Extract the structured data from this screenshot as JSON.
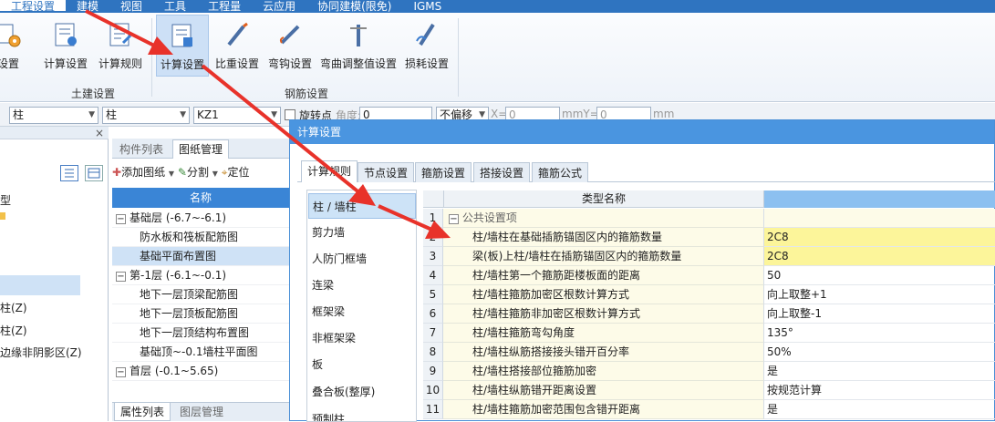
{
  "menubar": {
    "items": [
      "工程设置",
      "建模",
      "视图",
      "工具",
      "工程量",
      "云应用",
      "协同建模(限免)",
      "IGMS"
    ]
  },
  "ribbon": {
    "partial_button_label": "设置",
    "buttons": [
      {
        "label": "计算设置"
      },
      {
        "label": "计算规则"
      },
      {
        "label": "计算设置"
      },
      {
        "label": "比重设置"
      },
      {
        "label": "弯钩设置"
      },
      {
        "label": "弯曲调整值设置"
      },
      {
        "label": "损耗设置"
      }
    ],
    "groups": [
      "土建设置",
      "钢筋设置"
    ]
  },
  "propbar": {
    "combo1": "柱",
    "combo2": "柱",
    "combo3": "KZ1",
    "rotate_label": "旋转点",
    "angle_label": "角度:",
    "angle_value": "0",
    "offset_value": "不偏移",
    "x_label": "X=",
    "x_value": "0",
    "mm_y": "mmY=",
    "y_value": "0",
    "mm": "mm"
  },
  "leftpanel": {
    "close": "×",
    "items": [
      "型",
      "柱(Z)",
      "柱(Z)",
      "边缘非阴影区(Z)"
    ]
  },
  "midpanel": {
    "tabs": [
      "构件列表",
      "图纸管理"
    ],
    "toolbar": {
      "add": "添加图纸",
      "split": "分割",
      "locate": "定位"
    },
    "header": "名称",
    "rows": [
      {
        "text": "基础层 (-6.7~-6.1)",
        "group": true,
        "toggle": "−"
      },
      {
        "text": "防水板和筏板配筋图",
        "group": false
      },
      {
        "text": "基础平面布置图",
        "group": false,
        "selected": true
      },
      {
        "text": "第-1层 (-6.1~-0.1)",
        "group": true,
        "toggle": "−"
      },
      {
        "text": "地下一层顶梁配筋图",
        "group": false
      },
      {
        "text": "地下一层顶板配筋图",
        "group": false
      },
      {
        "text": "地下一层顶结构布置图",
        "group": false
      },
      {
        "text": "基础顶~-0.1墙柱平面图",
        "group": false
      },
      {
        "text": "首层 (-0.1~5.65)",
        "group": true,
        "toggle": "−"
      }
    ],
    "bottom_tabs": [
      "属性列表",
      "图层管理"
    ]
  },
  "dialog": {
    "title": "计算设置",
    "tabs": [
      "计算规则",
      "节点设置",
      "箍筋设置",
      "搭接设置",
      "箍筋公式"
    ],
    "categories": [
      "柱 / 墙柱",
      "剪力墙",
      "人防门框墙",
      "连梁",
      "框架梁",
      "非框架梁",
      "板",
      "叠合板(整厚)",
      "预制柱"
    ],
    "grid_header": "类型名称",
    "section": {
      "num": "1",
      "toggle": "−",
      "label": "公共设置项"
    },
    "rows": [
      {
        "num": "2",
        "name": "柱/墙柱在基础插筋锚固区内的箍筋数量",
        "value": "2C8",
        "hl": true
      },
      {
        "num": "3",
        "name": "梁(板)上柱/墙柱在插筋锚固区内的箍筋数量",
        "value": "2C8",
        "hl": true
      },
      {
        "num": "4",
        "name": "柱/墙柱第一个箍筋距楼板面的距离",
        "value": "50"
      },
      {
        "num": "5",
        "name": "柱/墙柱箍筋加密区根数计算方式",
        "value": "向上取整+1"
      },
      {
        "num": "6",
        "name": "柱/墙柱箍筋非加密区根数计算方式",
        "value": "向上取整-1"
      },
      {
        "num": "7",
        "name": "柱/墙柱箍筋弯勾角度",
        "value": "135°"
      },
      {
        "num": "8",
        "name": "柱/墙柱纵筋搭接接头错开百分率",
        "value": "50%"
      },
      {
        "num": "9",
        "name": "柱/墙柱搭接部位箍筋加密",
        "value": "是"
      },
      {
        "num": "10",
        "name": "柱/墙柱纵筋错开距离设置",
        "value": "按规范计算"
      },
      {
        "num": "11",
        "name": "柱/墙柱箍筋加密范围包含错开距离",
        "value": "是"
      }
    ]
  },
  "colors": {
    "accent": "#2f74c0",
    "title_bar": "#4a95e0",
    "arrow": "#e8322a",
    "highlight": "#fcf59a"
  }
}
